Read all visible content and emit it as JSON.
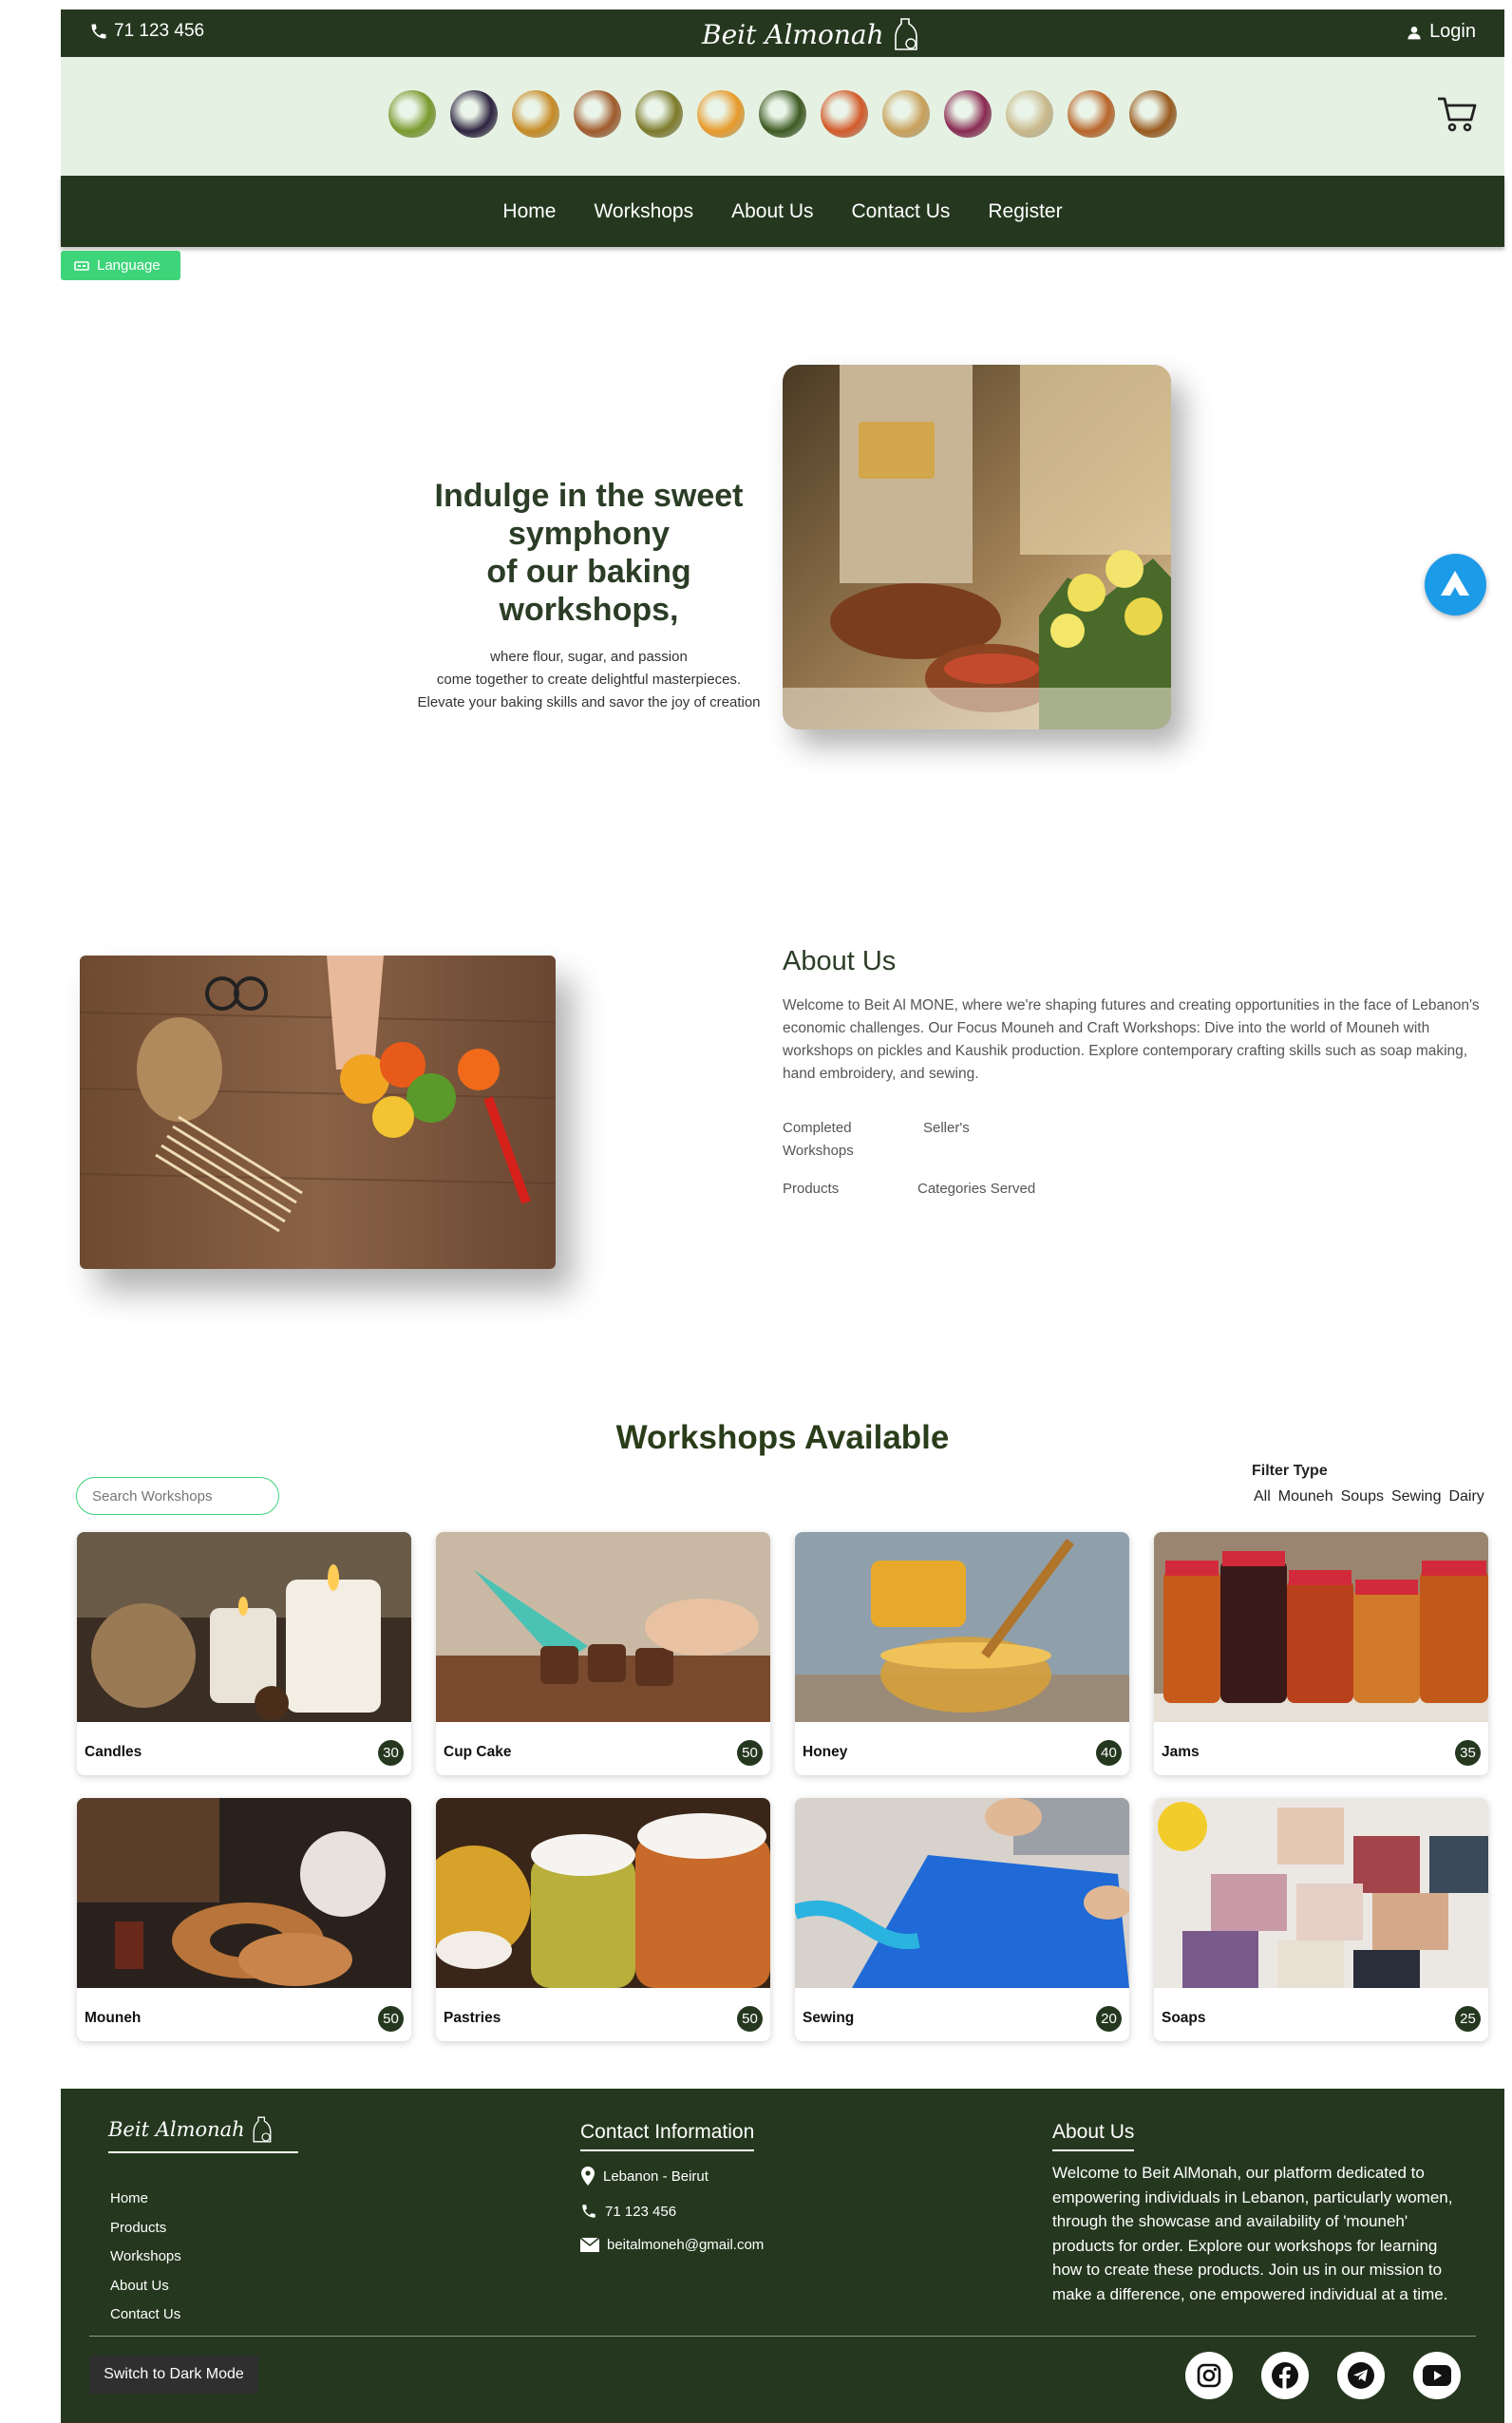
{
  "header": {
    "phone": "71 123 456",
    "logo_text": "Beit Almonah",
    "login_label": "Login"
  },
  "categories": [
    {
      "name": "grapes-icon",
      "color": "#7a9a2e"
    },
    {
      "name": "berries-icon",
      "color": "#2e2440"
    },
    {
      "name": "soup-bowl-icon",
      "color": "#c78a24"
    },
    {
      "name": "cinnamon-icon",
      "color": "#a05a2c"
    },
    {
      "name": "olive-oil-icon",
      "color": "#7d7a2a"
    },
    {
      "name": "honeycomb-icon",
      "color": "#e89a2a"
    },
    {
      "name": "stuffed-leaves-icon",
      "color": "#3e5a22"
    },
    {
      "name": "salad-icon",
      "color": "#d35a2a"
    },
    {
      "name": "dip-plate-icon",
      "color": "#c9a05a"
    },
    {
      "name": "jam-jar-icon",
      "color": "#8a2a52"
    },
    {
      "name": "bread-icon",
      "color": "#c9b88a"
    },
    {
      "name": "thread-spools-icon",
      "color": "#b9652a"
    },
    {
      "name": "falafel-icon",
      "color": "#9a5a1e"
    }
  ],
  "nav": {
    "items": [
      "Home",
      "Workshops",
      "About Us",
      "Contact Us",
      "Register"
    ]
  },
  "language_label": "Language",
  "hero": {
    "title_line1": "Indulge in the sweet",
    "title_line2": "symphony",
    "title_line3": "of our baking",
    "title_line4": "workshops,",
    "sub_line1": "where flour, sugar, and passion",
    "sub_line2": "come together to create delightful masterpieces.",
    "sub_line3": "Elevate your baking skills and savor the joy of creation"
  },
  "about": {
    "title": "About Us",
    "text": "Welcome to Beit Al MONE, where we're shaping futures and creating opportunities in the face of Lebanon's economic challenges. Our Focus Mouneh and Craft Workshops: Dive into the world of Mouneh with workshops on pickles and Kaushik production. Explore contemporary crafting skills such as soap making, hand embroidery, and sewing.",
    "stat1_line1": "Completed",
    "stat1_line2": "Workshops",
    "stat2": "Seller's",
    "stat3": "Products",
    "stat4": "Categories Served"
  },
  "workshops": {
    "title": "Workshops Available",
    "search_placeholder": "Search Workshops",
    "filter_label": "Filter Type",
    "filters": [
      "All",
      "Mouneh",
      "Soups",
      "Sewing",
      "Dairy"
    ],
    "cards": [
      {
        "name": "Candles",
        "count": "30"
      },
      {
        "name": "Cup Cake",
        "count": "50"
      },
      {
        "name": "Honey",
        "count": "40"
      },
      {
        "name": "Jams",
        "count": "35"
      },
      {
        "name": "Mouneh",
        "count": "50"
      },
      {
        "name": "Pastries",
        "count": "50"
      },
      {
        "name": "Sewing",
        "count": "20"
      },
      {
        "name": "Soaps",
        "count": "25"
      }
    ]
  },
  "footer": {
    "logo_text": "Beit Almonah",
    "links": [
      "Home",
      "Products",
      "Workshops",
      "About Us",
      "Contact Us"
    ],
    "contact_title": "Contact Information",
    "location": "Lebanon - Beirut",
    "phone": "71 123 456",
    "email": "beitalmoneh@gmail.com",
    "about_title": "About Us",
    "about_text": "Welcome to Beit AlMonah, our platform dedicated to empowering individuals in Lebanon, particularly women, through the showcase and availability of 'mouneh' products for order. Explore our workshops for learning how to create these products. Join us in our mission to make a difference, one empowered individual at a time.",
    "dark_mode_label": "Switch to Dark Mode"
  },
  "colors": {
    "primary_dark_green": "#25381f",
    "light_green": "#e5f2e3",
    "accent_green": "#3ed47a",
    "float_button_blue": "#1c9be8"
  }
}
